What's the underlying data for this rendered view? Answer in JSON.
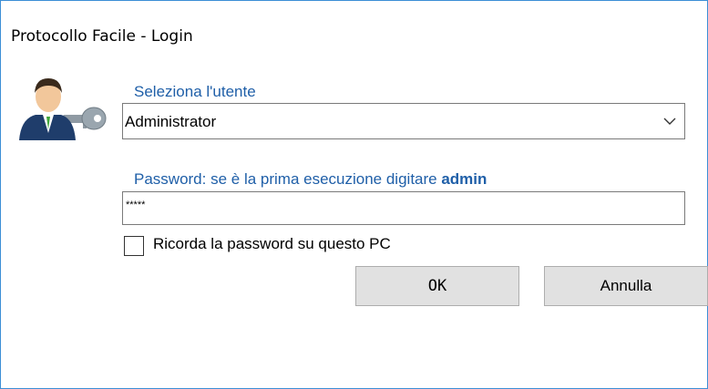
{
  "window": {
    "title": "Protocollo Facile - Login"
  },
  "user_select": {
    "label": "Seleziona l'utente",
    "value": "Administrator",
    "icon": "chevron-down-icon"
  },
  "password": {
    "label_prefix": "Password: se è la prima esecuzione digitare ",
    "label_bold": "admin",
    "masked_value": "*****"
  },
  "remember": {
    "label": "Ricorda la password su questo PC",
    "checked": false
  },
  "buttons": {
    "ok_label": "OK",
    "cancel_label": "Annulla"
  },
  "icons": {
    "avatar": "user-key-icon"
  },
  "colors": {
    "label_blue": "#1f5fa8",
    "window_border": "#3c8fd6",
    "button_bg": "#e1e1e1"
  }
}
